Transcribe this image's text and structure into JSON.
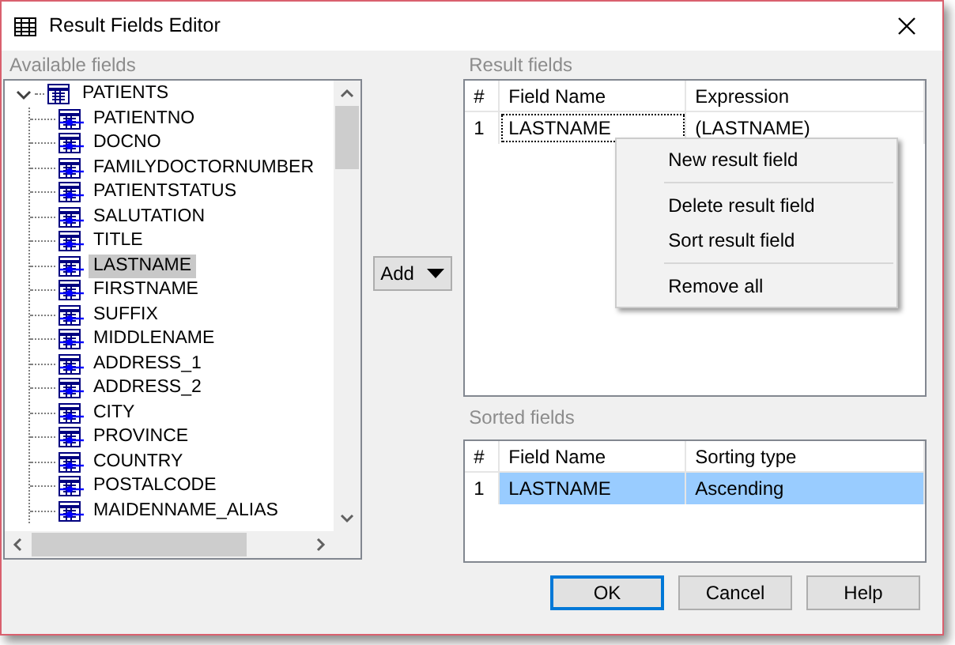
{
  "window": {
    "title": "Result Fields Editor"
  },
  "available_fields": {
    "label": "Available fields",
    "tree": [
      {
        "label": "PATIENTS",
        "expanded": true,
        "selected": false,
        "children": [
          {
            "label": "PATIENTNO",
            "selected": false
          },
          {
            "label": "DOCNO",
            "selected": false
          },
          {
            "label": "FAMILYDOCTORNUMBER",
            "selected": false
          },
          {
            "label": "PATIENTSTATUS",
            "selected": false
          },
          {
            "label": "SALUTATION",
            "selected": false
          },
          {
            "label": "TITLE",
            "selected": false
          },
          {
            "label": "LASTNAME",
            "selected": true
          },
          {
            "label": "FIRSTNAME",
            "selected": false
          },
          {
            "label": "SUFFIX",
            "selected": false
          },
          {
            "label": "MIDDLENAME",
            "selected": false
          },
          {
            "label": "ADDRESS_1",
            "selected": false
          },
          {
            "label": "ADDRESS_2",
            "selected": false
          },
          {
            "label": "CITY",
            "selected": false
          },
          {
            "label": "PROVINCE",
            "selected": false
          },
          {
            "label": "COUNTRY",
            "selected": false
          },
          {
            "label": "POSTALCODE",
            "selected": false
          },
          {
            "label": "MAIDENNAME_ALIAS",
            "selected": false
          }
        ]
      }
    ]
  },
  "add_button": {
    "label": "Add"
  },
  "result_fields": {
    "label": "Result fields",
    "columns": [
      "#",
      "Field Name",
      "Expression"
    ],
    "rows": [
      {
        "cells": [
          "1",
          "LASTNAME",
          "(LASTNAME)"
        ],
        "selected": false,
        "focused": true
      }
    ]
  },
  "context_menu": {
    "items": [
      {
        "kind": "item",
        "label": "New result field"
      },
      {
        "kind": "separator"
      },
      {
        "kind": "item",
        "label": "Delete result field"
      },
      {
        "kind": "item",
        "label": "Sort result field"
      },
      {
        "kind": "separator"
      },
      {
        "kind": "item",
        "label": "Remove all"
      }
    ]
  },
  "sorted_fields": {
    "label": "Sorted fields",
    "columns": [
      "#",
      "Field Name",
      "Sorting type"
    ],
    "rows": [
      {
        "cells": [
          "1",
          "LASTNAME",
          "Ascending"
        ],
        "selected": true,
        "focused": false
      }
    ]
  },
  "buttons": [
    {
      "label": "OK",
      "default": true
    },
    {
      "label": "Cancel",
      "default": false
    },
    {
      "label": "Help",
      "default": false
    }
  ]
}
